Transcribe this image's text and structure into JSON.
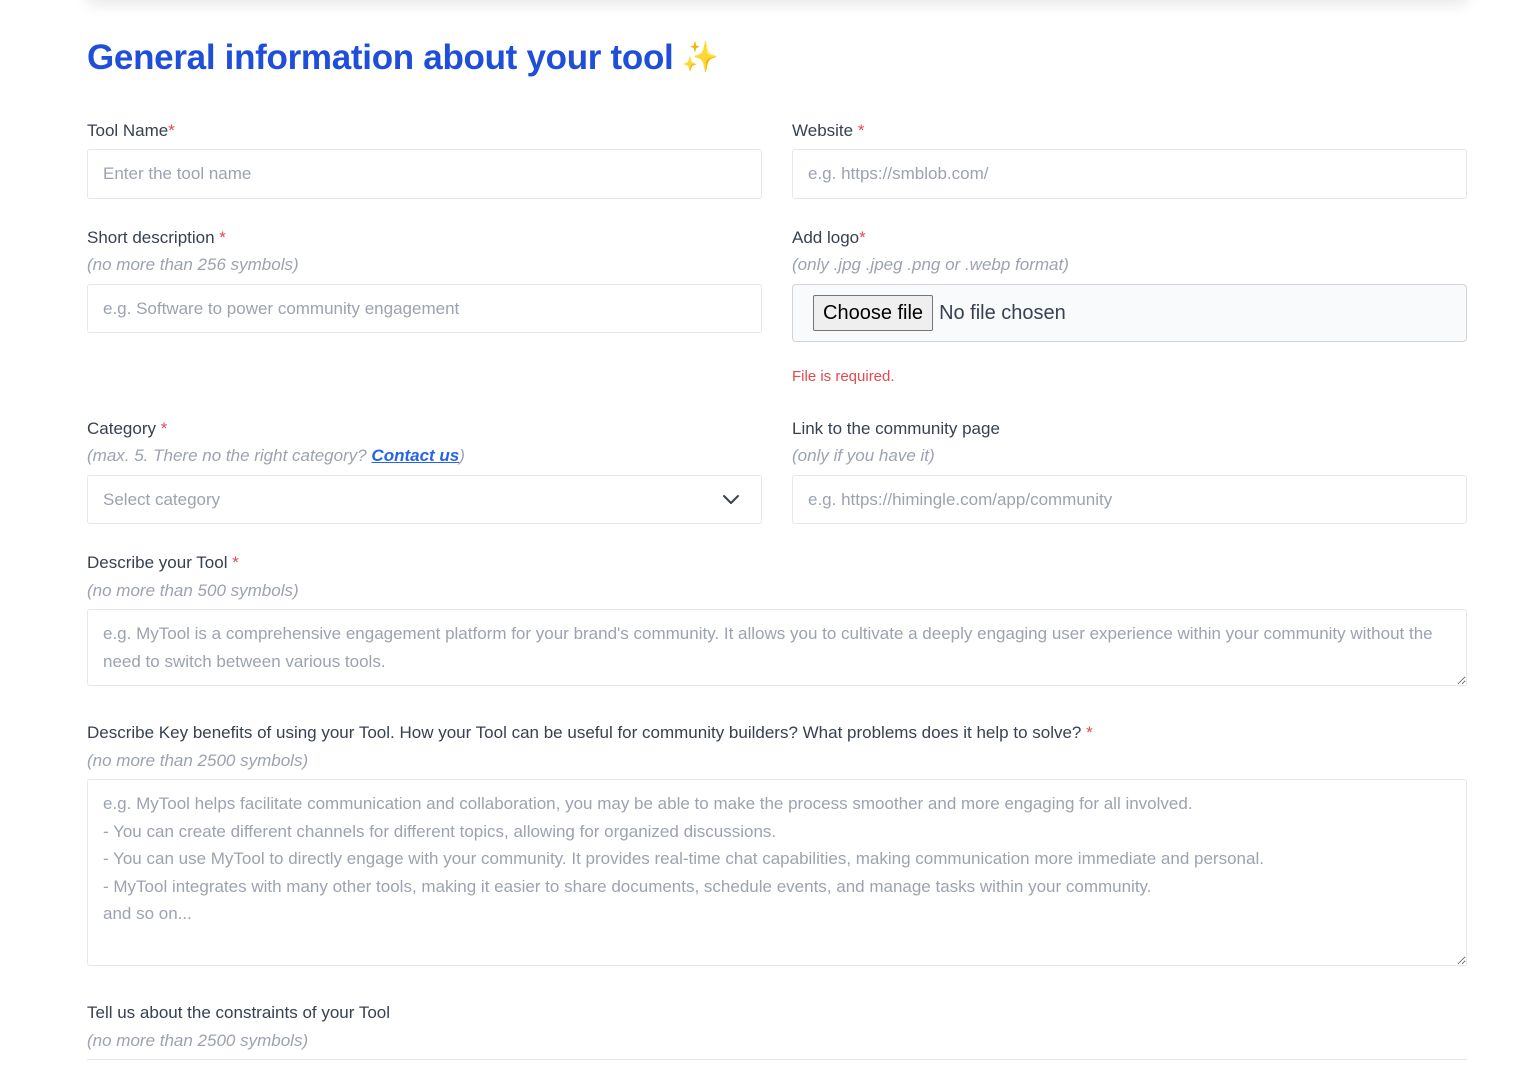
{
  "page": {
    "title": "General information about your tool",
    "title_emoji": "✨"
  },
  "fields": {
    "tool_name": {
      "label": "Tool Name",
      "required_mark": "*",
      "placeholder": "Enter the tool name",
      "value": ""
    },
    "website": {
      "label": "Website ",
      "required_mark": "*",
      "placeholder": "e.g. https://smblob.com/",
      "value": ""
    },
    "short_description": {
      "label": "Short description ",
      "required_mark": "*",
      "hint": "(no more than 256 symbols)",
      "placeholder": "e.g. Software to power community engagement",
      "value": ""
    },
    "logo": {
      "label": "Add logo",
      "required_mark": "*",
      "hint": "(only .jpg .jpeg .png or .webp format)",
      "button_label": "Choose file",
      "file_status": "No file chosen",
      "error": "File is required."
    },
    "category": {
      "label": "Category ",
      "required_mark": "*",
      "hint_prefix": "(max. 5. There no the right category? ",
      "hint_link": "Contact us",
      "hint_suffix": ")",
      "placeholder": "Select category",
      "icon": "chevron-down-icon"
    },
    "community_link": {
      "label": "Link to the community page",
      "hint": "(only if you have it)",
      "placeholder": "e.g. https://himingle.com/app/community",
      "value": ""
    },
    "describe_tool": {
      "label": "Describe your Tool ",
      "required_mark": "*",
      "hint": "(no more than 500 symbols)",
      "placeholder": "e.g. MyTool is a comprehensive engagement platform for your brand's community. It allows you to cultivate a deeply engaging user experience within your community without the need to switch between various tools.",
      "value": ""
    },
    "key_benefits": {
      "label": "Describe Key benefits of using your Tool. How your Tool can be useful for community builders? What problems does it help to solve? ",
      "required_mark": "*",
      "hint": "(no more than 2500 symbols)",
      "placeholder": "e.g. MyTool helps facilitate communication and collaboration, you may be able to make the process smoother and more engaging for all involved.\n- You can create different channels for different topics, allowing for organized discussions.\n- You can use MyTool to directly engage with your community. It provides real-time chat capabilities, making communication more immediate and personal.\n- MyTool integrates with many other tools, making it easier to share documents, schedule events, and manage tasks within your community.\nand so on...",
      "value": ""
    },
    "constraints": {
      "label": "Tell us about the constraints of your Tool",
      "hint": "(no more than 2500 symbols)"
    }
  },
  "colors": {
    "title": "#1f4fd8",
    "required": "#e5484d",
    "hint": "#9ca3af",
    "link": "#2563eb",
    "error": "#e5484d"
  }
}
